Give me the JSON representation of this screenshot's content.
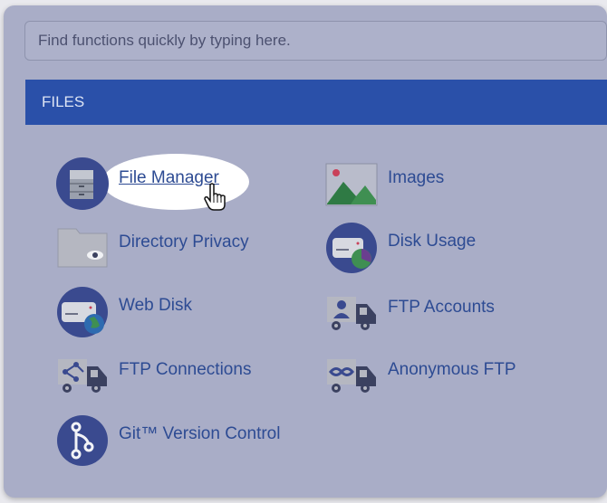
{
  "search": {
    "placeholder": "Find functions quickly by typing here."
  },
  "section": {
    "title": "FILES"
  },
  "items": [
    {
      "label": "File Manager",
      "icon": "file-manager-icon"
    },
    {
      "label": "Images",
      "icon": "images-icon"
    },
    {
      "label": "Directory Privacy",
      "icon": "directory-privacy-icon"
    },
    {
      "label": "Disk Usage",
      "icon": "disk-usage-icon"
    },
    {
      "label": "Web Disk",
      "icon": "web-disk-icon"
    },
    {
      "label": "FTP Accounts",
      "icon": "ftp-accounts-icon"
    },
    {
      "label": "FTP Connections",
      "icon": "ftp-connections-icon"
    },
    {
      "label": "Anonymous FTP",
      "icon": "anonymous-ftp-icon"
    },
    {
      "label": "Git™ Version Control",
      "icon": "git-version-control-icon"
    }
  ],
  "colors": {
    "header": "#2a50a9",
    "link": "#2d4b93",
    "panel": "#a9adc7"
  }
}
